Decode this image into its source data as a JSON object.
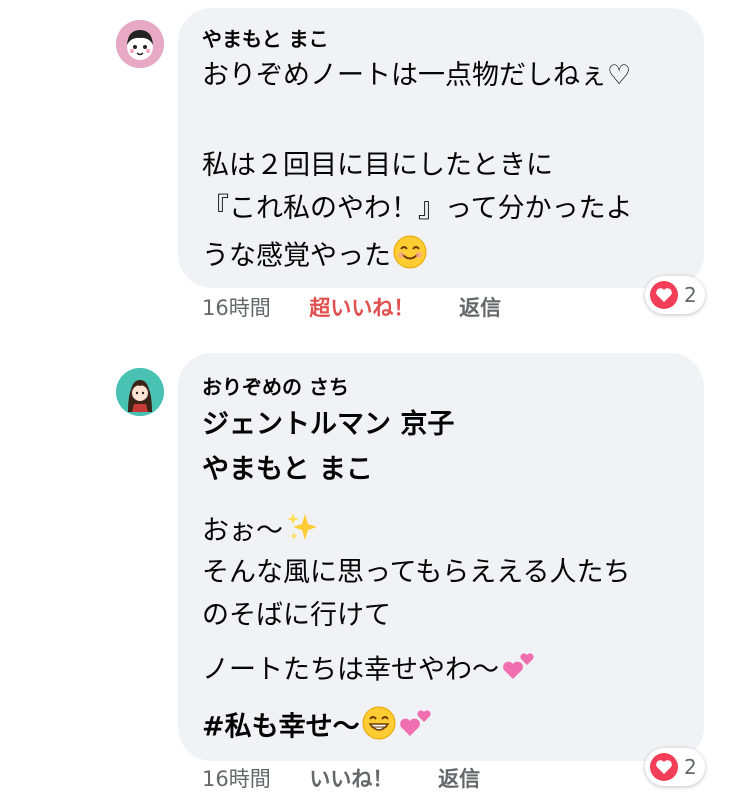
{
  "comments": [
    {
      "author": "やまもと まこ",
      "lines": [
        "おりぞめノートは一点物だしねぇ♡",
        "",
        "私は２回目に目にしたときに",
        "『これ私のやわ！』って分かったよ",
        "うな感覚やった"
      ],
      "time": "16時間",
      "like_label": "超いいね！",
      "reply_label": "返信",
      "reaction_count": "2",
      "avatar_icon": "girl-face-avatar-icon",
      "avatar_bg": "#e8a9c4"
    },
    {
      "author": "おりぞめの さち",
      "mentions": [
        "ジェントルマン 京子",
        "やまもと まこ"
      ],
      "lines": [
        "おぉ〜",
        "そんな風に思ってもらええる人たち",
        "のそばに行けて",
        "ノートたちは幸せやわ〜",
        "#私も幸せ〜"
      ],
      "time": "16時間",
      "like_label": "いいね！",
      "reply_label": "返信",
      "reaction_count": "2",
      "avatar_icon": "girl-illustration-avatar-icon",
      "avatar_bg": "#49c2b4"
    }
  ],
  "colors": {
    "bubble": "#f0f2f5",
    "super_like": "#e0504f",
    "meta_text": "#65676b",
    "heart": "#f33e58"
  }
}
